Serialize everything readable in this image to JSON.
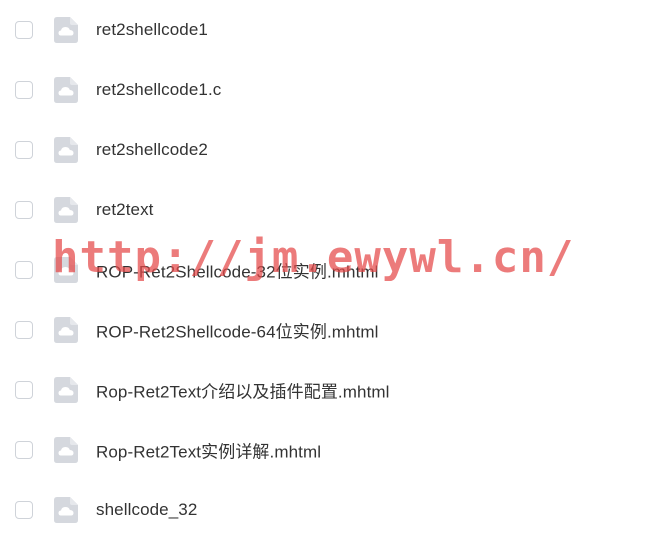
{
  "files": [
    {
      "name": "ret2shellcode1",
      "icon": "cloud-file-icon"
    },
    {
      "name": "ret2shellcode1.c",
      "icon": "cloud-file-icon"
    },
    {
      "name": "ret2shellcode2",
      "icon": "cloud-file-icon"
    },
    {
      "name": "ret2text",
      "icon": "cloud-file-icon"
    },
    {
      "name": "ROP-Ret2Shellcode-32位实例.mhtml",
      "icon": "cloud-file-icon"
    },
    {
      "name": "ROP-Ret2Shellcode-64位实例.mhtml",
      "icon": "cloud-file-icon"
    },
    {
      "name": "Rop-Ret2Text介绍以及插件配置.mhtml",
      "icon": "cloud-file-icon"
    },
    {
      "name": "Rop-Ret2Text实例详解.mhtml",
      "icon": "cloud-file-icon"
    },
    {
      "name": "shellcode_32",
      "icon": "cloud-file-icon"
    }
  ],
  "watermark": "http://jm.ewywl.cn/",
  "colors": {
    "text": "#333333",
    "checkbox_border": "#cfd3d9",
    "icon_fill": "#d5d8de",
    "watermark": "#e44848"
  }
}
